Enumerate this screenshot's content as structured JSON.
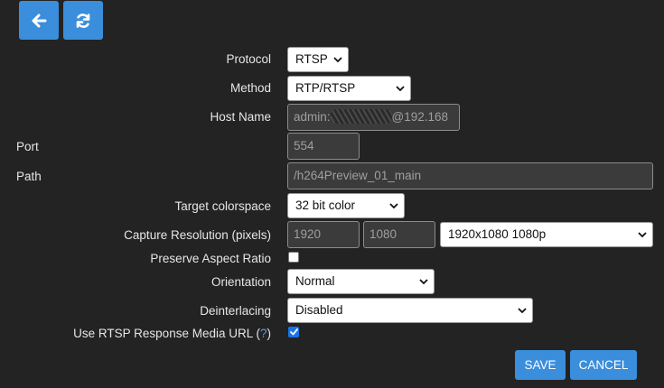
{
  "toolbar": {
    "back_icon": "arrow-left-icon",
    "refresh_icon": "refresh-icon"
  },
  "colors": {
    "accent": "#3a8edb",
    "background": "#232323",
    "checkbox_checked": "#1a73e8"
  },
  "form": {
    "protocol": {
      "label": "Protocol",
      "value": "RTSP"
    },
    "method": {
      "label": "Method",
      "value": "RTP/RTSP"
    },
    "host_name": {
      "label": "Host Name",
      "value_prefix": "admin:",
      "value_suffix": "@192.168"
    },
    "port": {
      "label": "Port",
      "value": "554"
    },
    "path": {
      "label": "Path",
      "value": "/h264Preview_01_main"
    },
    "target_colorspace": {
      "label": "Target colorspace",
      "value": "32 bit color"
    },
    "capture_resolution": {
      "label": "Capture Resolution (pixels)",
      "width": "1920",
      "height": "1080",
      "preset": "1920x1080 1080p"
    },
    "preserve_aspect_ratio": {
      "label": "Preserve Aspect Ratio",
      "checked": false
    },
    "orientation": {
      "label": "Orientation",
      "value": "Normal"
    },
    "deinterlacing": {
      "label": "Deinterlacing",
      "value": "Disabled"
    },
    "use_rtsp_response_media_url": {
      "label": "Use RTSP Response Media URL (",
      "help": "?",
      "label_end": ")",
      "checked": true
    }
  },
  "actions": {
    "save_label": "SAVE",
    "cancel_label": "CANCEL"
  }
}
